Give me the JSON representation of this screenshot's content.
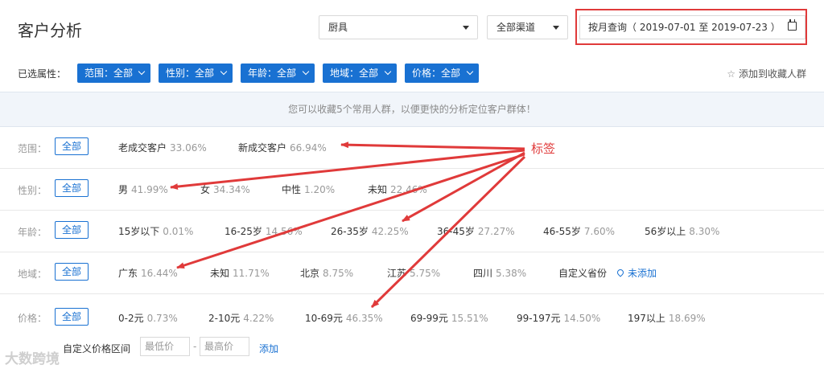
{
  "header": {
    "title": "客户分析",
    "category_value": "厨具",
    "channel_value": "全部渠道",
    "date_query": "按月查询（ 2019-07-01 至 2019-07-23 ）"
  },
  "filterbar": {
    "label": "已选属性：",
    "chips": [
      "范围：全部",
      "性别：全部",
      "年龄：全部",
      "地域：全部",
      "价格：全部"
    ],
    "favorite": "添加到收藏人群"
  },
  "tip": "您可以收藏5个常用人群，以便更快的分析定位客户群体！",
  "all_label": "全部",
  "rows": [
    {
      "label": "范围：",
      "options": [
        {
          "name": "老成交客户",
          "pct": "33.06%"
        },
        {
          "name": "新成交客户",
          "pct": "66.94%"
        }
      ]
    },
    {
      "label": "性别：",
      "options": [
        {
          "name": "男",
          "pct": "41.99%"
        },
        {
          "name": "女",
          "pct": "34.34%"
        },
        {
          "name": "中性",
          "pct": "1.20%"
        },
        {
          "name": "未知",
          "pct": "22.46%"
        }
      ]
    },
    {
      "label": "年龄：",
      "options": [
        {
          "name": "15岁以下",
          "pct": "0.01%"
        },
        {
          "name": "16-25岁",
          "pct": "14.56%"
        },
        {
          "name": "26-35岁",
          "pct": "42.25%"
        },
        {
          "name": "36-45岁",
          "pct": "27.27%"
        },
        {
          "name": "46-55岁",
          "pct": "7.60%"
        },
        {
          "name": "56岁以上",
          "pct": "8.30%"
        }
      ]
    },
    {
      "label": "地域：",
      "options": [
        {
          "name": "广东",
          "pct": "16.44%"
        },
        {
          "name": "未知",
          "pct": "11.71%"
        },
        {
          "name": "北京",
          "pct": "8.75%"
        },
        {
          "name": "江苏",
          "pct": "5.75%"
        },
        {
          "name": "四川",
          "pct": "5.38%"
        },
        {
          "name": "自定义省份",
          "pct": ""
        }
      ],
      "link": "未添加"
    },
    {
      "label": "价格：",
      "options": [
        {
          "name": "0-2元",
          "pct": "0.73%"
        },
        {
          "name": "2-10元",
          "pct": "4.22%"
        },
        {
          "name": "10-69元",
          "pct": "46.35%"
        },
        {
          "name": "69-99元",
          "pct": "15.51%"
        },
        {
          "name": "99-197元",
          "pct": "14.50%"
        },
        {
          "name": "197以上",
          "pct": "18.69%"
        }
      ]
    }
  ],
  "price_custom": {
    "label": "自定义价格区间",
    "min_placeholder": "最低价",
    "dash": "-",
    "max_placeholder": "最高价",
    "add": "添加"
  },
  "annotation": "标签",
  "watermark": "大数跨境",
  "colors": {
    "accent": "#1971d2",
    "annotation_red": "#e03a3a"
  }
}
